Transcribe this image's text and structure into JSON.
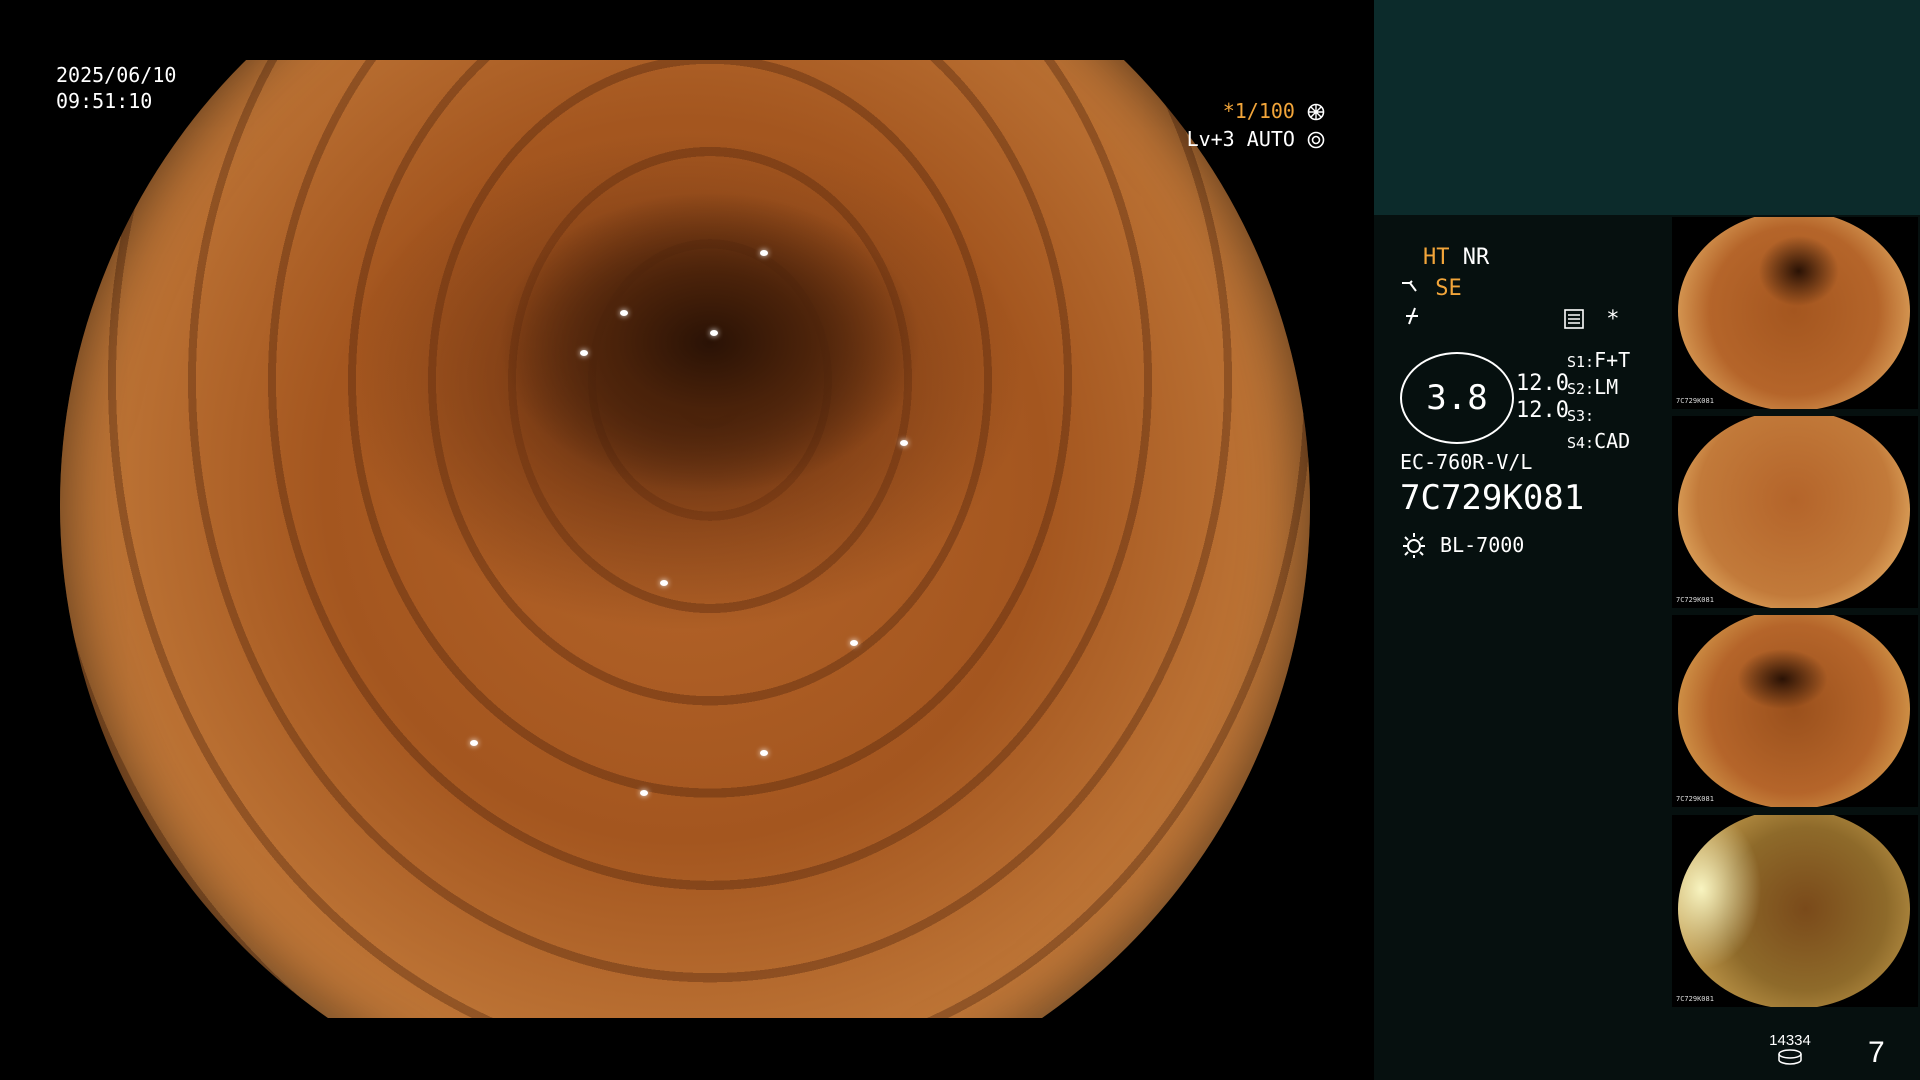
{
  "datetime": {
    "date": "2025/06/10",
    "time": "09:51:10"
  },
  "scope_settings": {
    "shutter": "*1/100",
    "level": "Lv+3",
    "mode": "AUTO"
  },
  "panel": {
    "ht": "HT",
    "nr": "NR",
    "se": "SE",
    "zoom_value": "3.8",
    "value_a": "12.0",
    "value_b": "12.0",
    "s1": "S1:",
    "s1_val": "F+T",
    "s2": "S2:",
    "s2_val": "LM",
    "s3": "S3:",
    "s3_val": "",
    "s4": "S4:",
    "s4_val": "CAD",
    "asterisk": "*",
    "scope_model": "EC-760R-V/L",
    "serial": "7C729K081",
    "light_source": "BL-7000"
  },
  "storage": {
    "count": "14334",
    "page": "7"
  },
  "thumbnails": [
    {
      "meta": "7C729K081"
    },
    {
      "meta": "7C729K081"
    },
    {
      "meta": "7C729K081"
    },
    {
      "meta": "7C729K081"
    }
  ],
  "colors": {
    "accent": "#f2a53a",
    "panel_top": "#0c2b2b",
    "panel": "#06100f"
  },
  "icons": [
    "shutter-wheel-icon",
    "auto-mode-icon",
    "scope-tip-icon",
    "freeze-icon",
    "settings-icon",
    "lamp-icon",
    "storage-icon"
  ]
}
